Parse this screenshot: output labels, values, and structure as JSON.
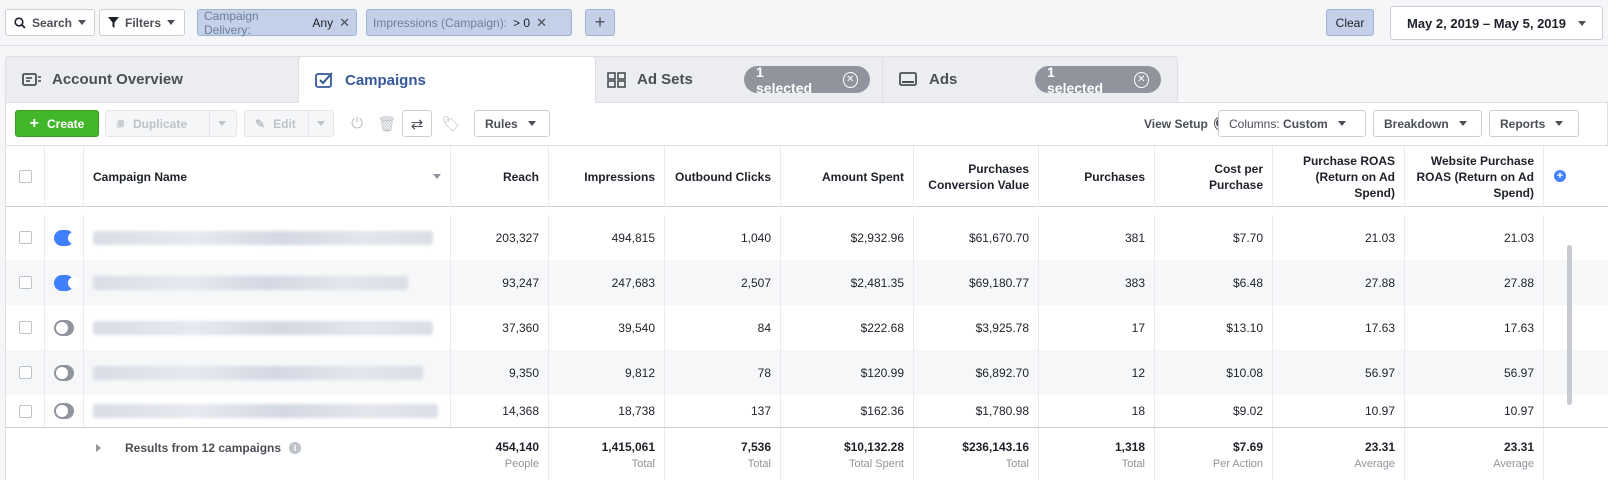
{
  "filterbar": {
    "search_label": "Search",
    "filters_label": "Filters",
    "chips": [
      {
        "key": "Campaign Delivery:",
        "value": "Any"
      },
      {
        "key": "Impressions (Campaign):",
        "value": "> 0"
      }
    ],
    "clear_label": "Clear",
    "date_range": "May 2, 2019 – May 5, 2019"
  },
  "tabs": [
    {
      "label": "Account Overview",
      "icon": "account-overview-icon"
    },
    {
      "label": "Campaigns",
      "icon": "campaigns-checkbox-icon",
      "active": true
    },
    {
      "label": "Ad Sets",
      "icon": "grid-icon",
      "selected": "1 selected"
    },
    {
      "label": "Ads",
      "icon": "ad-monitor-icon",
      "selected": "1 selected"
    }
  ],
  "toolbar": {
    "create_label": "Create",
    "duplicate_label": "Duplicate",
    "edit_label": "Edit",
    "rules_label": "Rules",
    "view_setup_label": "View Setup",
    "columns_prefix": "Columns:",
    "columns_value": "Custom",
    "breakdown_label": "Breakdown",
    "reports_label": "Reports"
  },
  "table": {
    "headers": {
      "name": "Campaign Name",
      "reach": "Reach",
      "impressions": "Impressions",
      "outbound": "Outbound Clicks",
      "spent": "Amount Spent",
      "pcv": "Purchases Conversion Value",
      "purchases": "Purchases",
      "cpp": "Cost per Purchase",
      "roas": "Purchase ROAS (Return on Ad Spend)",
      "wroas": "Website Purchase ROAS (Return on Ad Spend)"
    },
    "rows": [
      {
        "on": true,
        "reach": "203,327",
        "impressions": "494,815",
        "outbound": "1,040",
        "spent": "$2,932.96",
        "pcv": "$61,670.70",
        "purchases": "381",
        "cpp": "$7.70",
        "roas": "21.03",
        "wroas": "21.03"
      },
      {
        "on": true,
        "reach": "93,247",
        "impressions": "247,683",
        "outbound": "2,507",
        "spent": "$2,481.35",
        "pcv": "$69,180.77",
        "purchases": "383",
        "cpp": "$6.48",
        "roas": "27.88",
        "wroas": "27.88"
      },
      {
        "on": false,
        "reach": "37,360",
        "impressions": "39,540",
        "outbound": "84",
        "spent": "$222.68",
        "pcv": "$3,925.78",
        "purchases": "17",
        "cpp": "$13.10",
        "roas": "17.63",
        "wroas": "17.63"
      },
      {
        "on": false,
        "reach": "9,350",
        "impressions": "9,812",
        "outbound": "78",
        "spent": "$120.99",
        "pcv": "$6,892.70",
        "purchases": "12",
        "cpp": "$10.08",
        "roas": "56.97",
        "wroas": "56.97"
      },
      {
        "on": false,
        "reach": "14,368",
        "impressions": "18,738",
        "outbound": "137",
        "spent": "$162.36",
        "pcv": "$1,780.98",
        "purchases": "18",
        "cpp": "$9.02",
        "roas": "10.97",
        "wroas": "10.97"
      }
    ],
    "footer": {
      "results_label": "Results from 12 campaigns",
      "reach": {
        "value": "454,140",
        "label": "People"
      },
      "impressions": {
        "value": "1,415,061",
        "label": "Total"
      },
      "outbound": {
        "value": "7,536",
        "label": "Total"
      },
      "spent": {
        "value": "$10,132.28",
        "label": "Total Spent"
      },
      "pcv": {
        "value": "$236,143.16",
        "label": "Total"
      },
      "purchases": {
        "value": "1,318",
        "label": "Total"
      },
      "cpp": {
        "value": "$7.69",
        "label": "Per Action"
      },
      "roas": {
        "value": "23.31",
        "label": "Average"
      },
      "wroas": {
        "value": "23.31",
        "label": "Average"
      }
    }
  }
}
